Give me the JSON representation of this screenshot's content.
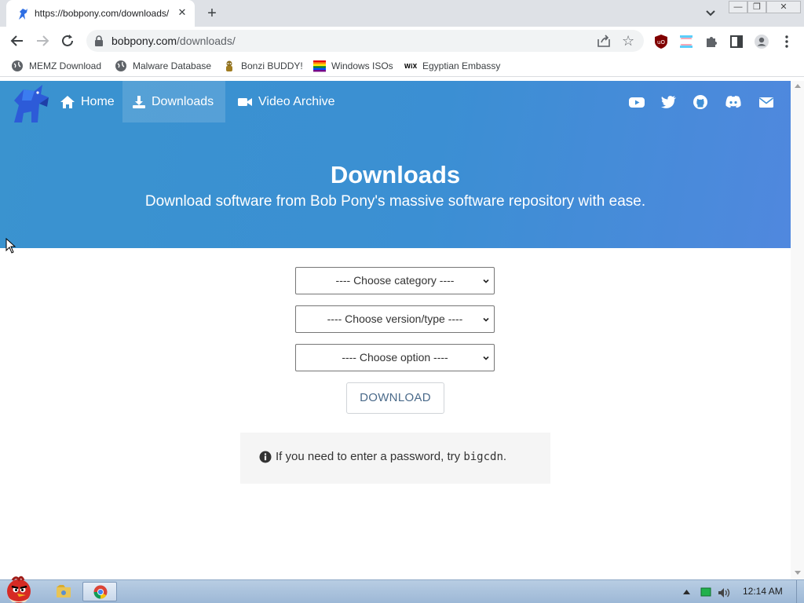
{
  "browser": {
    "tab_title": "https://bobpony.com/downloads/",
    "tab_close": "✕",
    "new_tab": "+",
    "url_host": "bobpony.com",
    "url_path": "/downloads/",
    "window_buttons": [
      "—",
      "❐",
      "✕"
    ]
  },
  "bookmarks": [
    {
      "label": "MEMZ Download",
      "icon": "globe-icon"
    },
    {
      "label": "Malware Database",
      "icon": "globe-icon"
    },
    {
      "label": "Bonzi BUDDY!",
      "icon": "bonzi-icon"
    },
    {
      "label": "Windows ISOs",
      "icon": "rainbow-flag-icon"
    },
    {
      "label": "Egyptian Embassy",
      "icon": "wix-icon",
      "icon_text": "WiX"
    }
  ],
  "site": {
    "nav": [
      {
        "label": "Home",
        "icon": "home-icon"
      },
      {
        "label": "Downloads",
        "icon": "download-icon",
        "active": true
      },
      {
        "label": "Video Archive",
        "icon": "video-icon"
      }
    ],
    "social": [
      "youtube-icon",
      "twitter-icon",
      "github-icon",
      "discord-icon",
      "mail-icon"
    ],
    "hero_title": "Downloads",
    "hero_subtitle": "Download software from Bob Pony's massive software repository with ease.",
    "selects": [
      "---- Choose category ----",
      "---- Choose version/type ----",
      "---- Choose option ----"
    ],
    "download_button": "DOWNLOAD",
    "notice_text": "If you need to enter a password, try",
    "notice_code": "bigcdn",
    "notice_end": "."
  },
  "taskbar": {
    "clock": "12:14 AM"
  },
  "colors": {
    "hero_start": "#3a93cf",
    "hero_end": "#5088de",
    "tabstrip": "#dee1e6"
  }
}
